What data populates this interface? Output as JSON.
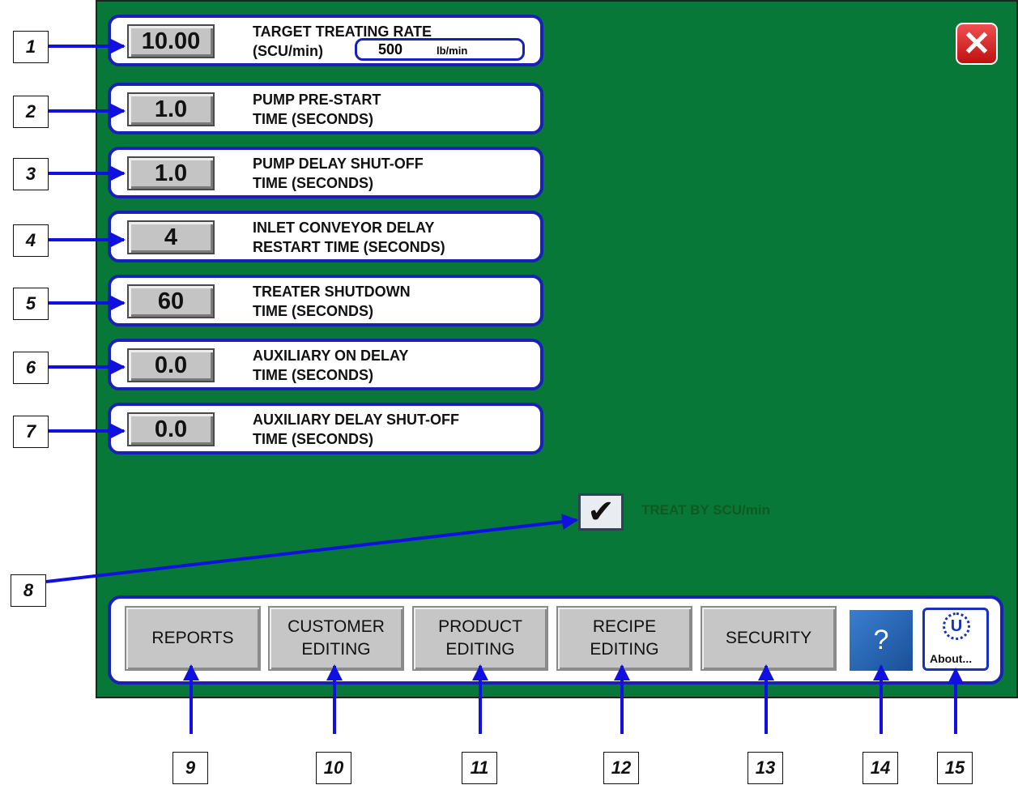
{
  "settings": [
    {
      "value": "10.00",
      "line1": "TARGET TREATING RATE",
      "line2": "(SCU/min)"
    },
    {
      "value": "1.0",
      "line1": "PUMP PRE-START",
      "line2": "TIME (SECONDS)"
    },
    {
      "value": "1.0",
      "line1": "PUMP DELAY SHUT-OFF",
      "line2": "TIME (SECONDS)"
    },
    {
      "value": "4",
      "line1": "INLET CONVEYOR DELAY",
      "line2": "RESTART TIME (SECONDS)"
    },
    {
      "value": "60",
      "line1": "TREATER SHUTDOWN",
      "line2": "TIME (SECONDS)"
    },
    {
      "value": "0.0",
      "line1": "AUXILIARY ON DELAY",
      "line2": "TIME (SECONDS)"
    },
    {
      "value": "0.0",
      "line1": "AUXILIARY DELAY SHUT-OFF",
      "line2": "TIME (SECONDS)"
    }
  ],
  "rate": {
    "value": "500",
    "unit": "lb/min"
  },
  "checkbox": {
    "label": "TREAT BY SCU/min",
    "checked": true
  },
  "nav": {
    "reports": "REPORTS",
    "customer_line1": "CUSTOMER",
    "customer_line2": "EDITING",
    "product_line1": "PRODUCT",
    "product_line2": "EDITING",
    "recipe_line1": "RECIPE",
    "recipe_line2": "EDITING",
    "security": "SECURITY",
    "help": "?",
    "about": "About...",
    "about_logo": "U"
  },
  "close_icon": "close-icon",
  "colors": {
    "screen_bg": "#087838",
    "border_blue": "#1820b8",
    "arrow_blue": "#1010e0",
    "close_red": "#e03030"
  },
  "callouts": [
    "1",
    "2",
    "3",
    "4",
    "5",
    "6",
    "7",
    "8",
    "9",
    "10",
    "11",
    "12",
    "13",
    "14",
    "15"
  ]
}
